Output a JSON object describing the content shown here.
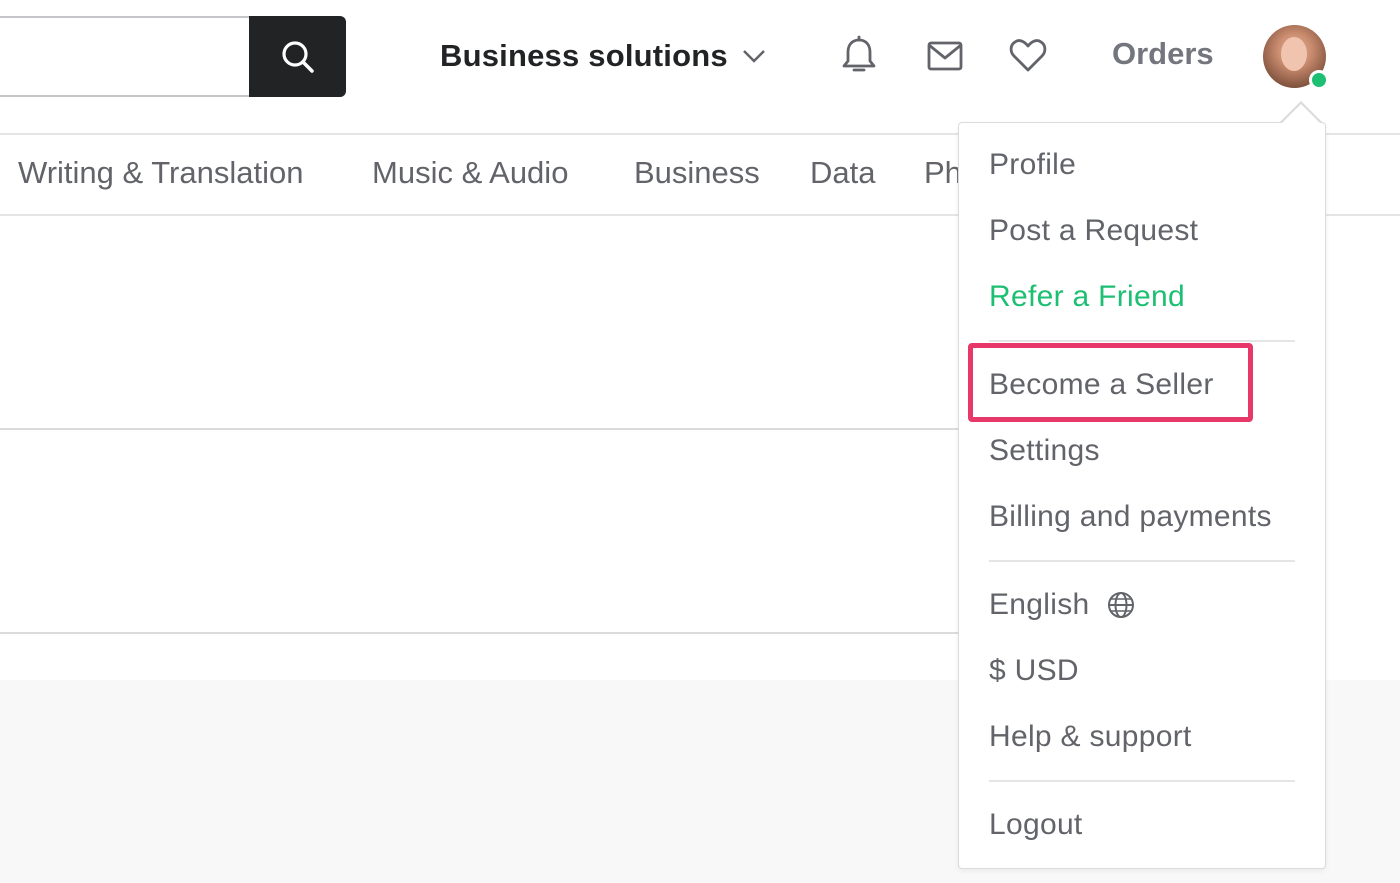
{
  "header": {
    "search": {
      "value": "",
      "placeholder": ""
    },
    "search_icon": "magnifier-icon",
    "business_solutions_label": "Business solutions",
    "icons": [
      "bell-icon",
      "envelope-icon",
      "heart-icon"
    ],
    "orders_label": "Orders",
    "avatar_status": "online"
  },
  "categories": [
    "Writing & Translation",
    "Music & Audio",
    "Business",
    "Data",
    "Ph"
  ],
  "dropdown": {
    "group1": [
      "Profile",
      "Post a Request",
      "Refer a Friend"
    ],
    "group2": [
      "Become a Seller",
      "Settings",
      "Billing and payments"
    ],
    "language_label": "English",
    "currency_label": "$ USD",
    "help_label": "Help & support",
    "logout_label": "Logout",
    "highlighted_item": "Become a Seller"
  },
  "colors": {
    "accent_green": "#1dbf73",
    "highlight_pink": "#e8386a",
    "search_button": "#222325"
  }
}
